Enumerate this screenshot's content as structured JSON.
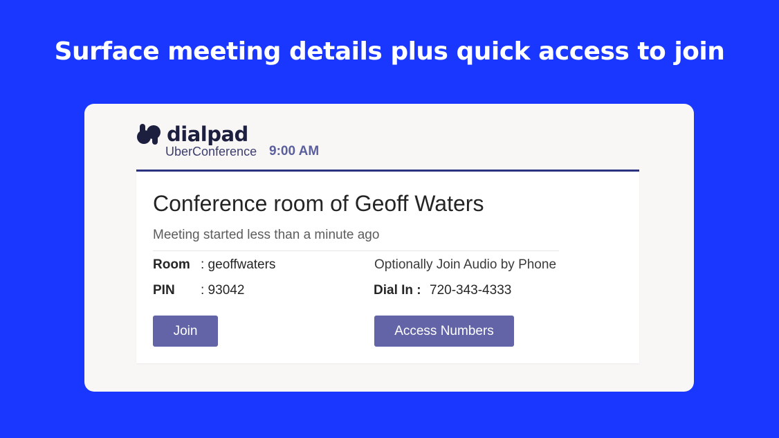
{
  "headline": "Surface meeting details plus quick access to join",
  "brand": {
    "logo_text": "dialpad",
    "logo_icon": "dialpad-logo-icon",
    "sub_brand": "UberConference",
    "time": "9:00 AM"
  },
  "meeting": {
    "title": "Conference room of Geoff Waters",
    "status": "Meeting started less than a minute ago",
    "room_label": "Room",
    "room_value": ": geoffwaters",
    "pin_label": "PIN",
    "pin_value": ": 93042",
    "audio_note": "Optionally Join Audio by Phone",
    "dial_label": "Dial In :",
    "dial_value": "720-343-4333"
  },
  "actions": {
    "join_label": "Join",
    "access_label": "Access Numbers"
  },
  "colors": {
    "background": "#1a37ff",
    "button": "#6264a7",
    "accent_border": "#2b3380",
    "time": "#5b5f9c"
  }
}
